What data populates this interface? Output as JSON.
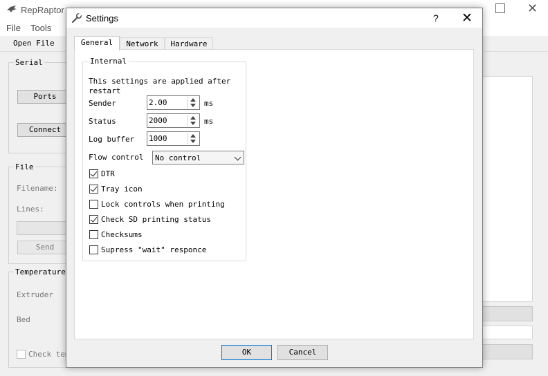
{
  "main_window": {
    "title": "RepRaptor",
    "menu": [
      "File",
      "Tools"
    ],
    "toolbar": {
      "open_file": "Open File"
    },
    "serial": {
      "title": "Serial",
      "ports_button": "Ports",
      "connect_button": "Connect"
    },
    "file": {
      "title": "File",
      "filename_label": "Filename:",
      "lines_label": "Lines:",
      "send_button": "Send"
    },
    "temperature": {
      "title": "Temperature",
      "extruder_label": "Extruder",
      "bed_label": "Bed",
      "check_temp_label": "Check tem"
    }
  },
  "dialog": {
    "title": "Settings",
    "help_label": "?",
    "close_label": "✕",
    "tabs": [
      "General",
      "Network",
      "Hardware"
    ],
    "active_tab": "General",
    "internal": {
      "title": "Internal",
      "note": "This settings are applied after restart",
      "sender": {
        "label": "Sender",
        "value": "2.00",
        "unit": "ms"
      },
      "status": {
        "label": "Status",
        "value": "2000",
        "unit": "ms"
      },
      "log_buffer": {
        "label": "Log buffer",
        "value": "1000"
      },
      "flow_control": {
        "label": "Flow control",
        "value": "No control"
      },
      "checkboxes": [
        {
          "label": "DTR",
          "checked": true
        },
        {
          "label": "Tray icon",
          "checked": true
        },
        {
          "label": "Lock controls when printing",
          "checked": false
        },
        {
          "label": "Check SD printing status",
          "checked": true
        },
        {
          "label": "Checksums",
          "checked": false
        },
        {
          "label": "Supress \"wait\" responce",
          "checked": false
        }
      ]
    },
    "ok_button": "OK",
    "cancel_button": "Cancel"
  }
}
